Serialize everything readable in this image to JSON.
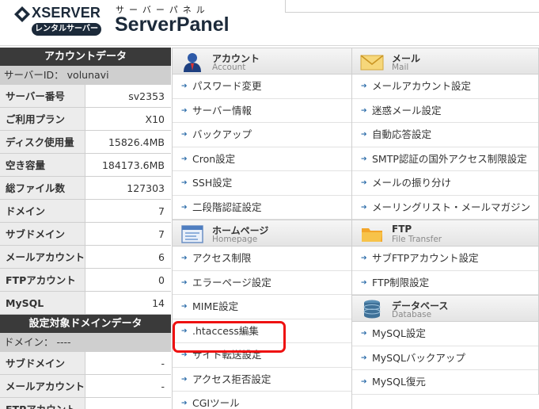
{
  "header": {
    "logo_word": "XSERVER",
    "logo_badge": "レンタルサーバー",
    "brand_sub": "サーバーパネル",
    "brand_main": "ServerPanel"
  },
  "account_panel": {
    "title": "アカウントデータ",
    "server_id": "サーバーID： volunavi",
    "rows": [
      {
        "label": "サーバー番号",
        "value": "sv2353"
      },
      {
        "label": "ご利用プラン",
        "value": "X10"
      },
      {
        "label": "ディスク使用量",
        "value": "15826.4MB"
      },
      {
        "label": "空き容量",
        "value": "184173.6MB"
      },
      {
        "label": "総ファイル数",
        "value": "127303"
      },
      {
        "label": "ドメイン",
        "value": "7"
      },
      {
        "label": "サブドメイン",
        "value": "7"
      },
      {
        "label": "メールアカウント",
        "value": "6"
      },
      {
        "label": "FTPアカウント",
        "value": "0"
      },
      {
        "label": "MySQL",
        "value": "14"
      }
    ]
  },
  "domain_panel": {
    "title": "設定対象ドメインデータ",
    "domain": "ドメイン： ----",
    "rows": [
      {
        "label": "サブドメイン",
        "value": "-"
      },
      {
        "label": "メールアカウント",
        "value": "-"
      },
      {
        "label": "FTPアカウント",
        "value": ""
      }
    ]
  },
  "sections": {
    "account": {
      "title": "アカウント",
      "subtitle": "Account",
      "icon": "user-icon",
      "items": [
        "パスワード変更",
        "サーバー情報",
        "バックアップ",
        "Cron設定",
        "SSH設定",
        "二段階認証設定"
      ]
    },
    "homepage": {
      "title": "ホームページ",
      "subtitle": "Homepage",
      "icon": "browser-window-icon",
      "items": [
        "アクセス制限",
        "エラーページ設定",
        "MIME設定",
        ".htaccess編集",
        "サイト転送設定",
        "アクセス拒否設定",
        "CGIツール"
      ]
    },
    "mail": {
      "title": "メール",
      "subtitle": "Mail",
      "icon": "envelope-icon",
      "items": [
        "メールアカウント設定",
        "迷惑メール設定",
        "自動応答設定",
        "SMTP認証の国外アクセス制限設定",
        "メールの振り分け",
        "メーリングリスト・メールマガジン"
      ]
    },
    "ftp": {
      "title": "FTP",
      "subtitle": "File Transfer",
      "icon": "folder-icon",
      "items": [
        "サブFTPアカウント設定",
        "FTP制限設定"
      ]
    },
    "database": {
      "title": "データベース",
      "subtitle": "Database",
      "icon": "database-icon",
      "items": [
        "MySQL設定",
        "MySQLバックアップ",
        "MySQL復元"
      ]
    }
  },
  "colors": {
    "highlight_border": "#ee1111",
    "link_arrow": "#2a6ba8",
    "panel_header": "#3a3a3a"
  }
}
